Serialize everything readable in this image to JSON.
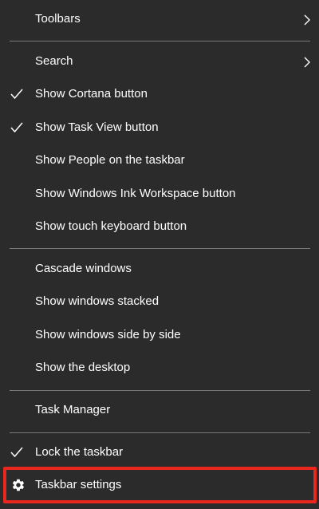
{
  "menu": {
    "items": [
      {
        "label": "Toolbars",
        "checked": false,
        "submenu": true
      },
      {
        "label": "Search",
        "checked": false,
        "submenu": true
      },
      {
        "label": "Show Cortana button",
        "checked": true
      },
      {
        "label": "Show Task View button",
        "checked": true
      },
      {
        "label": "Show People on the taskbar",
        "checked": false
      },
      {
        "label": "Show Windows Ink Workspace button",
        "checked": false
      },
      {
        "label": "Show touch keyboard button",
        "checked": false
      },
      {
        "label": "Cascade windows",
        "checked": false
      },
      {
        "label": "Show windows stacked",
        "checked": false
      },
      {
        "label": "Show windows side by side",
        "checked": false
      },
      {
        "label": "Show the desktop",
        "checked": false
      },
      {
        "label": "Task Manager",
        "checked": false
      },
      {
        "label": "Lock the taskbar",
        "checked": true
      },
      {
        "label": "Taskbar settings",
        "icon": "gear-icon",
        "highlighted": true
      }
    ]
  },
  "colors": {
    "background": "#2b2b2b",
    "text": "#ffffff",
    "separator": "#7a7a7a",
    "highlight_border": "#e8281f"
  }
}
